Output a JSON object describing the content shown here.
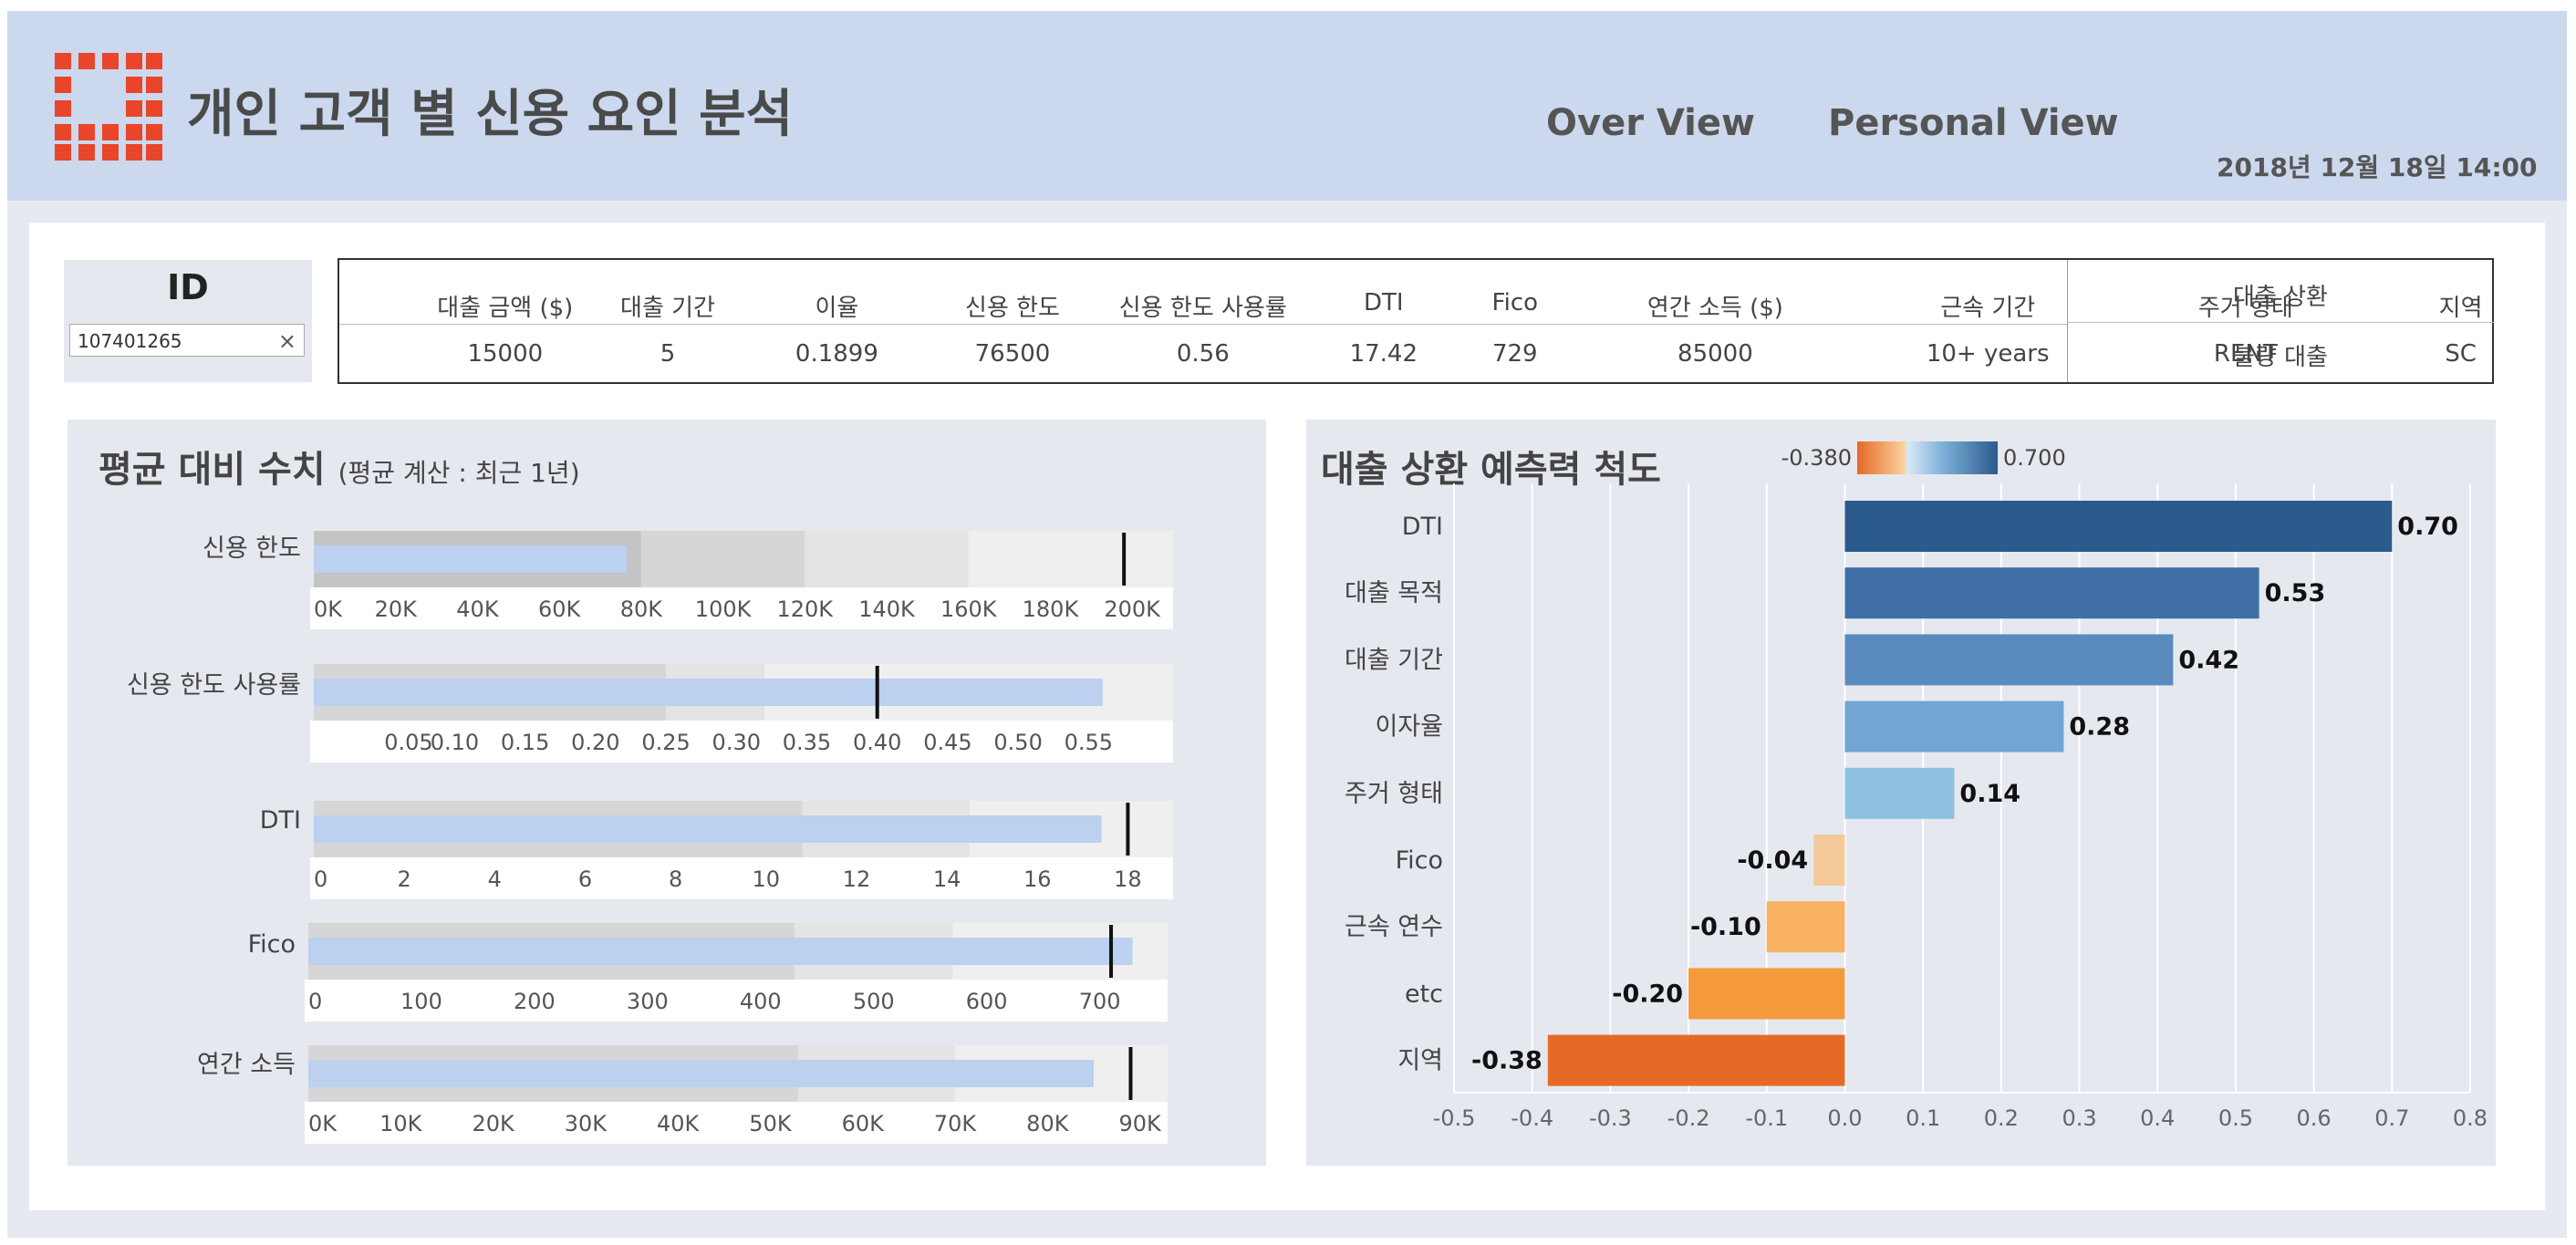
{
  "header": {
    "title": "개인 고객 별 신용 요인 분석",
    "nav": [
      "Over View",
      "Personal View"
    ],
    "datetime": "2018년 12월 18일 14:00"
  },
  "id_filter": {
    "label": "ID",
    "value": "107401265",
    "clear": "×"
  },
  "customer_info": {
    "columns": [
      "대출 금액 ($)",
      "대출 기간",
      "이율",
      "신용 한도",
      "신용 한도 사용률",
      "DTI",
      "Fico",
      "연간 소득 ($)",
      "근속 기간",
      "주거 형태",
      "지역"
    ],
    "values": [
      "15000",
      "5",
      "0.1899",
      "76500",
      "0.56",
      "17.42",
      "729",
      "85000",
      "10+ years",
      "RENT",
      "SC"
    ],
    "result_header": "대출 상환",
    "result_value": "불량 대출"
  },
  "left_panel": {
    "title": "평균 대비 수치",
    "subtitle": "(평균 계산 : 최근 1년)"
  },
  "right_panel": {
    "title": "대출 상환 예측력 척도",
    "legend_min": "-0.380",
    "legend_max": "0.700"
  },
  "chart_data": [
    {
      "type": "bullet",
      "bullets": [
        {
          "name": "신용 한도",
          "value": 76500,
          "target": 198000,
          "ranges": [
            80000,
            120000,
            160000,
            210000
          ],
          "axis_min": 0,
          "axis_max": 210000,
          "ticks": [
            0,
            20000,
            40000,
            60000,
            80000,
            100000,
            120000,
            140000,
            160000,
            180000,
            200000
          ],
          "tick_labels": [
            "0K",
            "20K",
            "40K",
            "60K",
            "80K",
            "100K",
            "120K",
            "140K",
            "160K",
            "180K",
            "200K"
          ]
        },
        {
          "name": "신용 한도 사용률",
          "value": 0.56,
          "target": 0.4,
          "ranges": [
            0.25,
            0.32,
            0.61
          ],
          "axis_min": 0,
          "axis_max": 0.61,
          "ticks": [
            0.05,
            0.1,
            0.15,
            0.2,
            0.25,
            0.3,
            0.35,
            0.4,
            0.45,
            0.5,
            0.55
          ],
          "tick_labels": [
            "0.05",
            "0.10",
            "0.15",
            "0.20",
            "0.25",
            "0.30",
            "0.35",
            "0.40",
            "0.45",
            "0.50",
            "0.55"
          ]
        },
        {
          "name": "DTI",
          "value": 17.42,
          "target": 18.0,
          "ranges": [
            10.8,
            14.5,
            19.0
          ],
          "axis_min": 0,
          "axis_max": 19.0,
          "ticks": [
            0,
            2,
            4,
            6,
            8,
            10,
            12,
            14,
            16,
            18
          ],
          "tick_labels": [
            "0",
            "2",
            "4",
            "6",
            "8",
            "10",
            "12",
            "14",
            "16",
            "18"
          ]
        },
        {
          "name": "Fico",
          "value": 729,
          "target": 710,
          "ranges": [
            430,
            570,
            760
          ],
          "axis_min": 0,
          "axis_max": 760,
          "ticks": [
            0,
            100,
            200,
            300,
            400,
            500,
            600,
            700
          ],
          "tick_labels": [
            "0",
            "100",
            "200",
            "300",
            "400",
            "500",
            "600",
            "700"
          ]
        },
        {
          "name": "연간 소득",
          "value": 85000,
          "target": 89000,
          "ranges": [
            53000,
            70000,
            93000
          ],
          "axis_min": 0,
          "axis_max": 93000,
          "ticks": [
            0,
            10000,
            20000,
            30000,
            40000,
            50000,
            60000,
            70000,
            80000,
            90000
          ],
          "tick_labels": [
            "0K",
            "10K",
            "20K",
            "30K",
            "40K",
            "50K",
            "60K",
            "70K",
            "80K",
            "90K"
          ]
        }
      ]
    },
    {
      "type": "bar",
      "orientation": "horizontal",
      "categories": [
        "DTI",
        "대출 목적",
        "대출 기간",
        "이자율",
        "주거 형태",
        "Fico",
        "근속 연수",
        "etc",
        "지역"
      ],
      "values": [
        0.7,
        0.53,
        0.42,
        0.28,
        0.14,
        -0.04,
        -0.1,
        -0.2,
        -0.38
      ],
      "value_labels": [
        "0.70",
        "0.53",
        "0.42",
        "0.28",
        "0.14",
        "-0.04",
        "-0.10",
        "-0.20",
        "-0.38"
      ],
      "colors": [
        "#2b5a8d",
        "#3f6fa6",
        "#5a8bbf",
        "#72a5d1",
        "#8ec1e1",
        "#f4c99a",
        "#f8b160",
        "#f59a3c",
        "#e56a26"
      ],
      "xlim": [
        -0.5,
        0.8
      ],
      "xticks": [
        -0.5,
        -0.4,
        -0.3,
        -0.2,
        -0.1,
        0.0,
        0.1,
        0.2,
        0.3,
        0.4,
        0.5,
        0.6,
        0.7,
        0.8
      ],
      "xtick_labels": [
        "-0.5",
        "-0.4",
        "-0.3",
        "-0.2",
        "-0.1",
        "0.0",
        "0.1",
        "0.2",
        "0.3",
        "0.4",
        "0.5",
        "0.6",
        "0.7",
        "0.8"
      ]
    }
  ]
}
